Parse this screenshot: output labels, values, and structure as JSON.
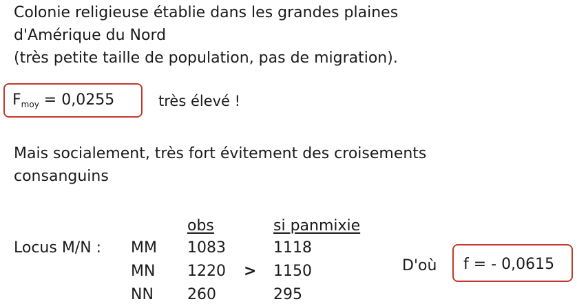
{
  "intro": {
    "line1": "Colonie religieuse établie dans les grandes plaines",
    "line2": "d'Amérique du Nord",
    "line3": "(très petite taille de population, pas de migration)."
  },
  "fmoy": {
    "letter": "F",
    "subscript": "moy",
    "value": "= 0,0255",
    "comment": "très élevé !"
  },
  "social": {
    "line1": "Mais socialement, très fort évitement des croisements",
    "line2": "consanguins"
  },
  "locus": {
    "label": "Locus M/N :",
    "header_obs": "obs",
    "header_panmixie": "si panmixie",
    "rows": [
      {
        "genotype": "MM",
        "obs": "1083",
        "panmixie": "1118"
      },
      {
        "genotype": "MN",
        "obs": "1220",
        "panmixie": "1150"
      },
      {
        "genotype": "NN",
        "obs": "260",
        "panmixie": "295"
      }
    ],
    "comparison": ">"
  },
  "conclusion": {
    "label": "D'où",
    "value": "f = - 0,0615"
  },
  "accent_color": "#c0392b"
}
